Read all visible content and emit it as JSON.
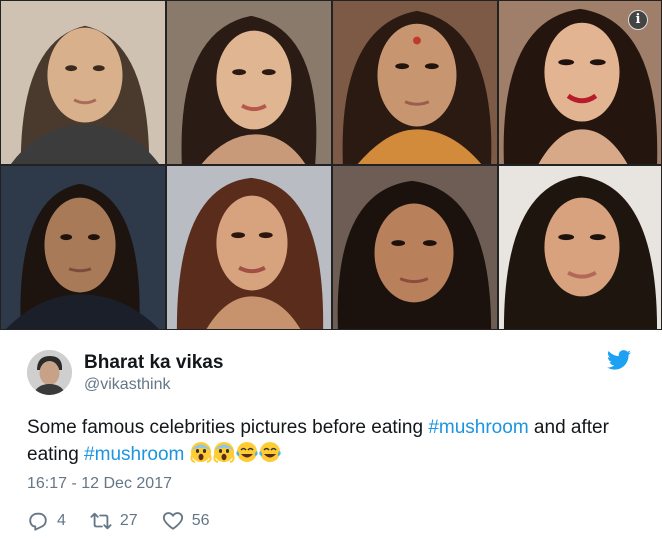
{
  "photos": [
    {
      "name": "photo-rani-before"
    },
    {
      "name": "photo-rani-after"
    },
    {
      "name": "photo-deepika-before"
    },
    {
      "name": "photo-deepika-after"
    },
    {
      "name": "photo-bipasha-before"
    },
    {
      "name": "photo-bipasha-after"
    },
    {
      "name": "photo-priyanka-before"
    },
    {
      "name": "photo-priyanka-after"
    }
  ],
  "info_badge": "i",
  "tweet": {
    "author_name": "Bharat ka vikas",
    "author_handle": "@vikasthink",
    "text_part1": "Some famous celebrities pictures before eating ",
    "hashtag1": "#mushroom",
    "text_part2": " and after eating ",
    "hashtag2": "#mushroom",
    "emojis": [
      "face-screaming-in-fear",
      "face-screaming-in-fear",
      "face-with-tears-of-joy",
      "face-with-tears-of-joy"
    ],
    "timestamp": "16:17 - 12 Dec 2017",
    "replies": "4",
    "retweets": "27",
    "likes": "56"
  },
  "colors": {
    "hashtag": "#1b95e0",
    "meta": "#657786",
    "twitter_blue": "#1da1f2"
  },
  "icons": {
    "reply": "reply-icon",
    "retweet": "retweet-icon",
    "like": "heart-icon",
    "brand": "twitter-bird-icon"
  }
}
